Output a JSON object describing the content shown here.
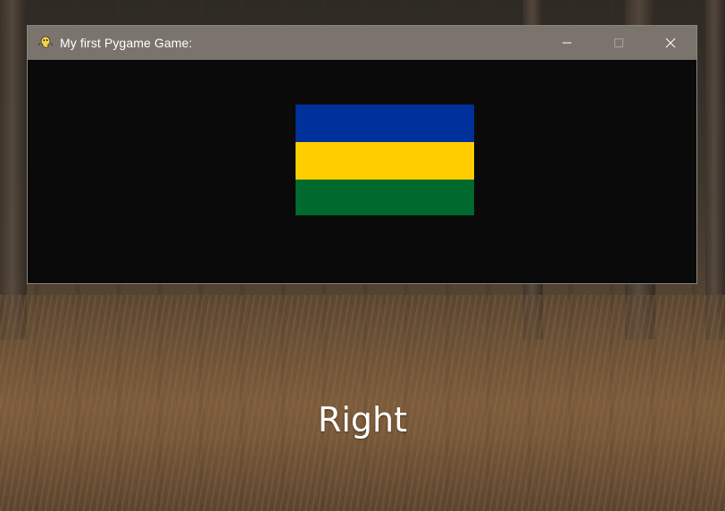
{
  "window": {
    "title": "My first Pygame Game:",
    "icon": "pygame-snake-icon",
    "controls": {
      "minimize_icon": "minimize-icon",
      "maximize_icon": "maximize-icon",
      "close_icon": "close-icon"
    }
  },
  "flag": {
    "stripes": [
      {
        "name": "blue-stripe",
        "color": "#00309a"
      },
      {
        "name": "yellow-stripe",
        "color": "#ffcd00"
      },
      {
        "name": "green-stripe",
        "color": "#006a2e"
      }
    ]
  },
  "caption": {
    "text": "Right"
  },
  "colors": {
    "titlebar": "#7b746d",
    "canvas": "#0a0a0a"
  }
}
